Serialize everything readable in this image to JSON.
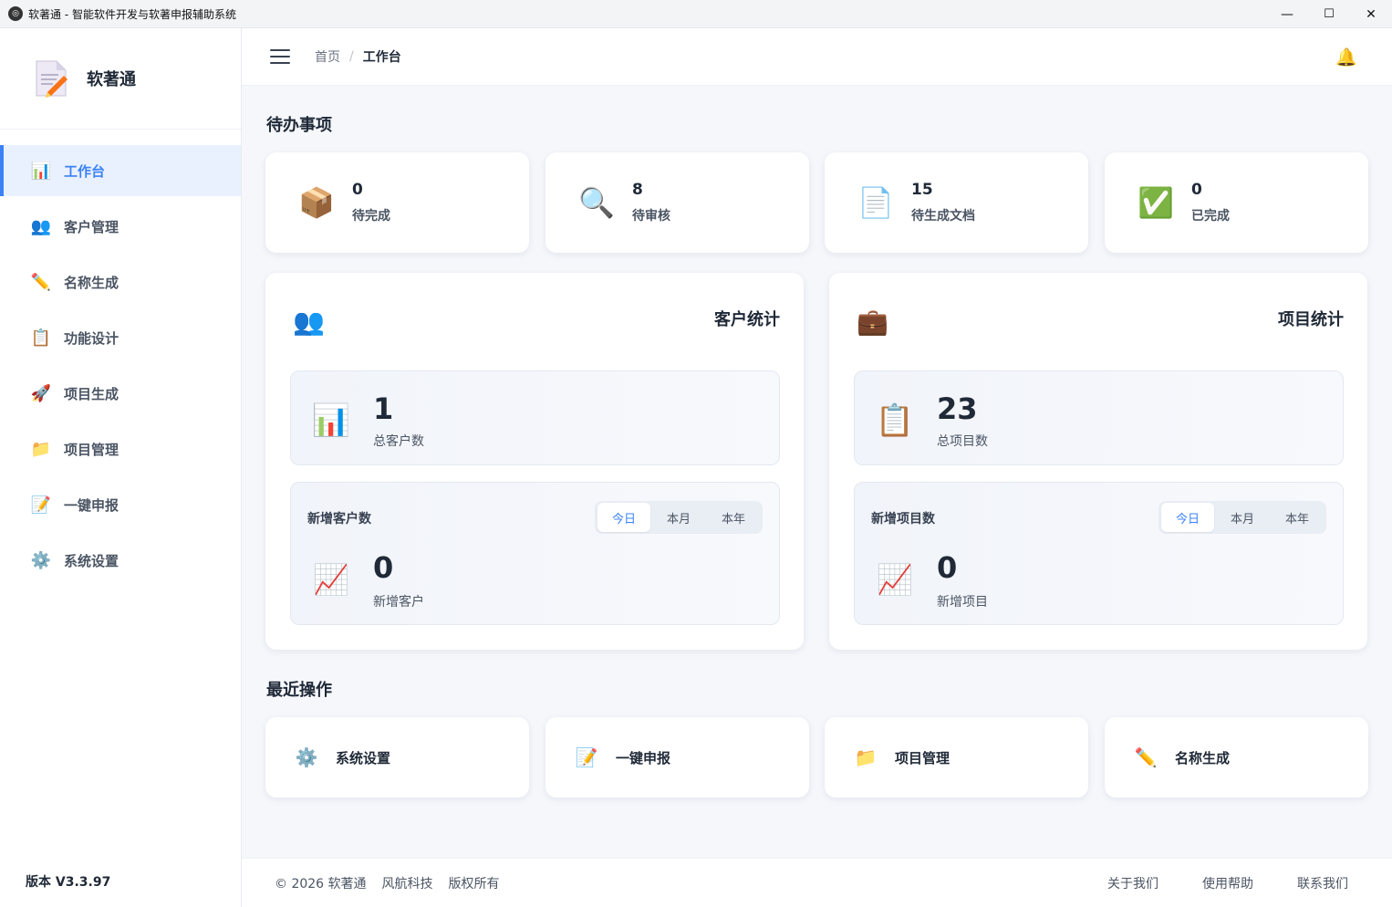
{
  "window": {
    "title": "软著通 - 智能软件开发与软著申报辅助系统",
    "minimize": "—",
    "maximize": "☐",
    "close": "✕"
  },
  "sidebar": {
    "brand": "软著通",
    "version": "版本 V3.3.97",
    "items": [
      {
        "label": "工作台",
        "icon": "bar-chart-icon",
        "glyph": "📊",
        "active": true
      },
      {
        "label": "客户管理",
        "icon": "users-icon",
        "glyph": "👥"
      },
      {
        "label": "名称生成",
        "icon": "pencil-icon",
        "glyph": "✏️"
      },
      {
        "label": "功能设计",
        "icon": "clipboard-icon",
        "glyph": "📋"
      },
      {
        "label": "项目生成",
        "icon": "rocket-icon",
        "glyph": "🚀"
      },
      {
        "label": "项目管理",
        "icon": "folder-icon",
        "glyph": "📁"
      },
      {
        "label": "一键申报",
        "icon": "document-pen-icon",
        "glyph": "📝"
      },
      {
        "label": "系统设置",
        "icon": "gear-icon",
        "glyph": "⚙️"
      }
    ]
  },
  "header": {
    "breadcrumb_home": "首页",
    "breadcrumb_sep": "/",
    "breadcrumb_current": "工作台",
    "bell_glyph": "🔔"
  },
  "todo": {
    "title": "待办事项",
    "items": [
      {
        "value": "0",
        "label": "待完成",
        "icon": "package-icon",
        "glyph": "📦"
      },
      {
        "value": "8",
        "label": "待审核",
        "icon": "magnifier-icon",
        "glyph": "🔍"
      },
      {
        "value": "15",
        "label": "待生成文档",
        "icon": "document-icon",
        "glyph": "📄"
      },
      {
        "value": "0",
        "label": "已完成",
        "icon": "check-icon",
        "glyph": "✅"
      }
    ]
  },
  "customer_stats": {
    "title": "客户统计",
    "head_glyph": "👥",
    "total_value": "1",
    "total_label": "总客户数",
    "total_glyph": "📊",
    "new_title": "新增客户数",
    "tabs": [
      "今日",
      "本月",
      "本年"
    ],
    "active_tab": "今日",
    "new_value": "0",
    "new_label": "新增客户",
    "new_glyph": "📈"
  },
  "project_stats": {
    "title": "项目统计",
    "head_glyph": "💼",
    "total_value": "23",
    "total_label": "总项目数",
    "total_glyph": "📋",
    "new_title": "新增项目数",
    "tabs": [
      "今日",
      "本月",
      "本年"
    ],
    "active_tab": "今日",
    "new_value": "0",
    "new_label": "新增项目",
    "new_glyph": "📈"
  },
  "recent": {
    "title": "最近操作",
    "items": [
      {
        "label": "系统设置",
        "icon": "gear-icon",
        "glyph": "⚙️"
      },
      {
        "label": "一键申报",
        "icon": "document-pen-icon",
        "glyph": "📝"
      },
      {
        "label": "项目管理",
        "icon": "folder-icon",
        "glyph": "📁"
      },
      {
        "label": "名称生成",
        "icon": "pencil-icon",
        "glyph": "✏️"
      }
    ]
  },
  "footer": {
    "copyright": "© 2026 软著通",
    "company": "风航科技",
    "rights": "版权所有",
    "links": [
      "关于我们",
      "使用帮助",
      "联系我们"
    ]
  }
}
